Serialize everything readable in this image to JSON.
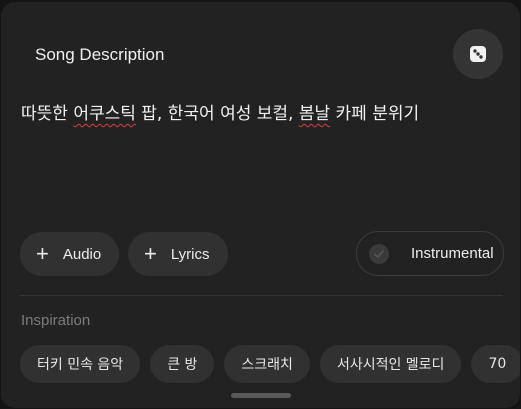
{
  "header": {
    "title": "Song Description",
    "dice_icon": "dice-icon"
  },
  "description": {
    "segments": [
      {
        "text": "따뜻한 ",
        "misspelled": false
      },
      {
        "text": "어쿠스틱",
        "misspelled": true
      },
      {
        "text": " 팝, 한국어 여성 보컬, ",
        "misspelled": false
      },
      {
        "text": "봄날",
        "misspelled": true
      },
      {
        "text": " 카페 분위기",
        "misspelled": false
      }
    ]
  },
  "actions": {
    "audio_label": "Audio",
    "lyrics_label": "Lyrics",
    "instrumental_label": "Instrumental",
    "instrumental_on": false
  },
  "inspiration": {
    "label": "Inspiration",
    "chips": [
      "터키 민속 음악",
      "큰 방",
      "스크래치",
      "서사시적인 멜로디",
      "70"
    ]
  },
  "colors": {
    "panel": "#222222",
    "pill": "#313131",
    "spellcheck": "#e03c3c"
  }
}
